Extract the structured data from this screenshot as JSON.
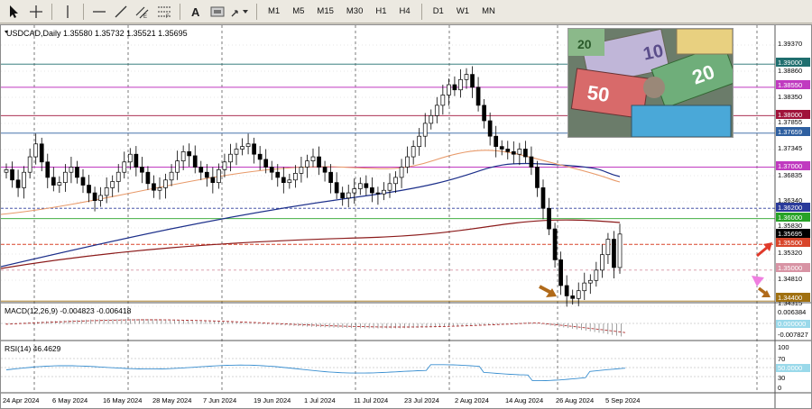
{
  "toolbar": {
    "timeframes": [
      "M1",
      "M5",
      "M15",
      "M30",
      "H1",
      "H4",
      "D1",
      "W1",
      "MN"
    ]
  },
  "header": {
    "symbol_text": "USDCAD,Daily  1.35580 1.35732 1.35521 1.35695"
  },
  "main_axis": {
    "ticks": [
      "1.39370",
      "1.38860",
      "1.38350",
      "1.37855",
      "1.37345",
      "1.36835",
      "1.36340",
      "1.35830",
      "1.35320",
      "1.34810",
      "1.34315"
    ]
  },
  "level_labels": [
    {
      "text": "1.39000",
      "color": "#1f6e6e"
    },
    {
      "text": "1.38550",
      "color": "#c03ac0"
    },
    {
      "text": "1.38000",
      "color": "#a0133a"
    },
    {
      "text": "1.37659",
      "color": "#2e5fa0"
    },
    {
      "text": "1.37000",
      "color": "#c03ac0"
    },
    {
      "text": "1.36200",
      "color": "#2a3a9a"
    },
    {
      "text": "1.36000",
      "color": "#27a227"
    },
    {
      "text": "1.35695",
      "color": "#000000"
    },
    {
      "text": "1.35500",
      "color": "#d8452a"
    },
    {
      "text": "1.35000",
      "color": "#d893a4"
    },
    {
      "text": "1.34400",
      "color": "#a07010"
    }
  ],
  "macd": {
    "header": "MACD(12,26,9) -0.004823 -0.006418",
    "ticks": [
      "0.006384",
      "0.000000",
      "-0.007827"
    ]
  },
  "rsi": {
    "header": "RSI(14) 46.4629",
    "ticks": [
      "100",
      "70",
      "50.0000",
      "30",
      "0"
    ]
  },
  "date_axis": {
    "labels": [
      "24 Apr 2024",
      "6 May 2024",
      "16 May 2024",
      "28 May 2024",
      "7 Jun 2024",
      "19 Jun 2024",
      "1 Jul 2024",
      "11 Jul 2024",
      "23 Jul 2024",
      "2 Aug 2024",
      "14 Aug 2024",
      "26 Aug 2024",
      "5 Sep 2024"
    ]
  },
  "banner": {
    "notes": [
      "10",
      "50",
      "20",
      "20"
    ]
  },
  "colors": {
    "bull_candle": "#ffffff",
    "bear_candle": "#000000",
    "ma_red": "#8b1a1a",
    "ma_blue": "#1c2f8a",
    "ma_orange": "#e89a6a",
    "rsi_line": "#3a8fd0"
  }
}
